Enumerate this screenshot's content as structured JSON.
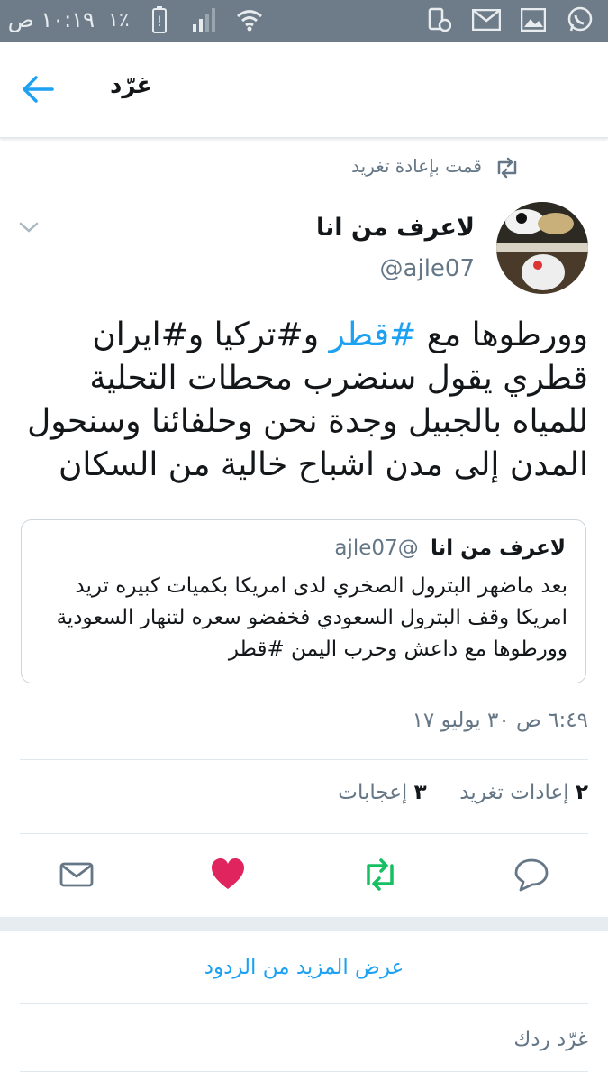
{
  "status_bar": {
    "time": "١٠:١٩ ص",
    "battery_percent": "١٪"
  },
  "header": {
    "title": "غرّد"
  },
  "retweet_context": {
    "label": "قمت بإعادة تغريد"
  },
  "tweet": {
    "author_name": "لاعرف من انا",
    "handle": "@ajle07",
    "text_before": "وورطوها مع ",
    "hashtag": "#قطر",
    "text_after": " و#تركيا و#ايران قطري يقول سنضرب محطات التحلية للمياه بالجبيل وجدة نحن وحلفائنا وسنحول المدن إلى مدن اشباح خالية من السكان",
    "timestamp": "٦:٤٩ ص ٣٠ يوليو ١٧",
    "retweets_count": "٢",
    "retweets_label": "إعادات تغريد",
    "likes_count": "٣",
    "likes_label": "إعجابات"
  },
  "quoted_tweet": {
    "author_name": "لاعرف من انا",
    "handle": "@ajle07",
    "text": "بعد ماضهر البترول الصخري لدى امريكا بكميات كبيره تريد امريكا وقف البترول السعودي فخفضو سعره لتنهار السعودية وورطوها مع داعش وحرب اليمن #قطر"
  },
  "replies": {
    "show_more": "عرض المزيد من الردود",
    "placeholder": "غرّد ردك"
  },
  "colors": {
    "accent": "#1da1f2",
    "like": "#e0245e",
    "retweet": "#17bf63",
    "muted": "#657786",
    "status_bar": "#6d7c88"
  },
  "icons": [
    "back-arrow-icon",
    "retweet-icon",
    "chevron-down-icon",
    "mail-icon",
    "heart-icon",
    "reply-icon"
  ]
}
